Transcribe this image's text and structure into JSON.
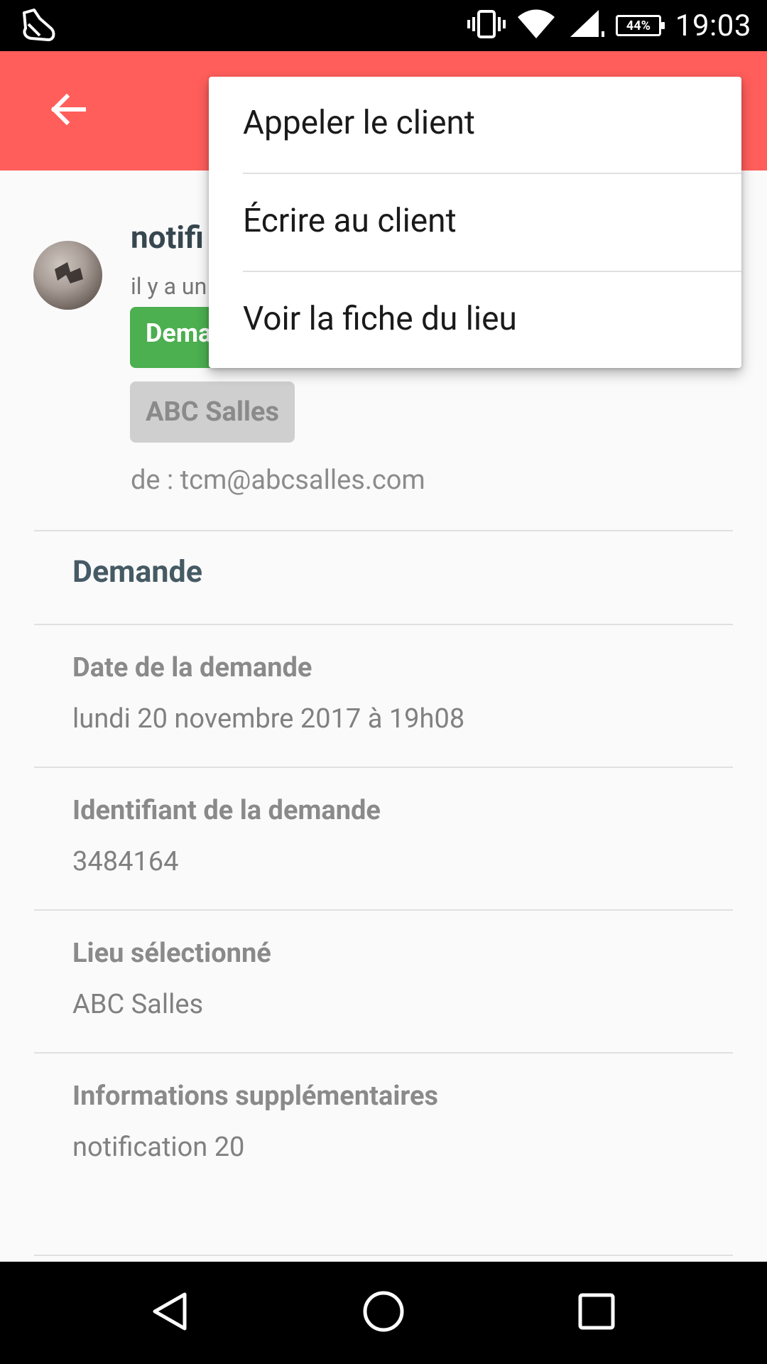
{
  "status_bar": {
    "time": "19:03",
    "battery": "44%",
    "icons": [
      "notification-icon",
      "vibrate-icon",
      "wifi-icon",
      "signal-icon",
      "battery-icon"
    ]
  },
  "app_bar": {
    "back_icon": "arrow-back-icon",
    "background_color": "#ff5e5b"
  },
  "notification": {
    "title": "notifi",
    "subtitle": "il y a un",
    "status_badge": "Dema",
    "status_color": "#4caf50",
    "venue_badge": "ABC Salles",
    "from": "de : tcm@abcsalles.com"
  },
  "section": {
    "title": "Demande"
  },
  "fields": [
    {
      "label": "Date de la demande",
      "value": "lundi 20 novembre 2017 à 19h08"
    },
    {
      "label": "Identifiant de la demande",
      "value": "3484164"
    },
    {
      "label": "Lieu sélectionné",
      "value": "ABC Salles"
    },
    {
      "label": "Informations supplémentaires",
      "value": "notification 20"
    }
  ],
  "menu": {
    "items": [
      "Appeler le client",
      "Écrire au client",
      "Voir la fiche du lieu"
    ]
  },
  "nav_bar": {
    "icons": [
      "back-triangle-icon",
      "home-circle-icon",
      "recents-square-icon"
    ]
  }
}
